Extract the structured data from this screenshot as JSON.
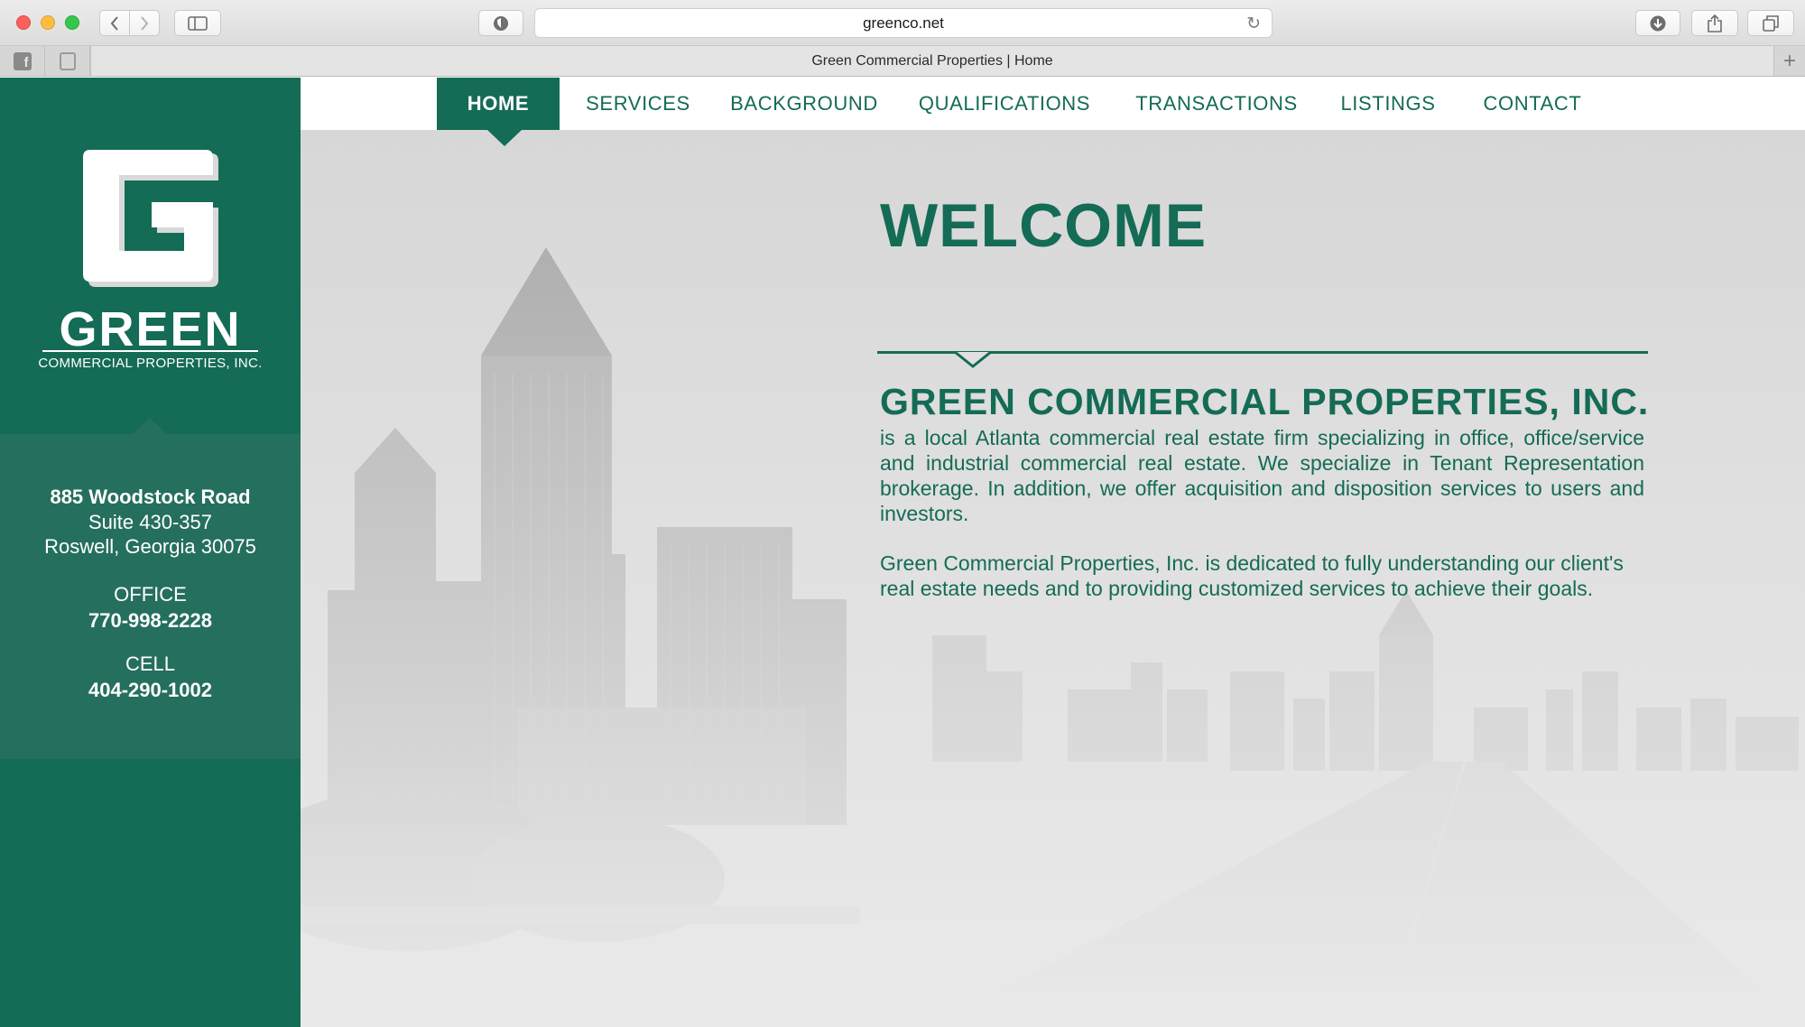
{
  "browser": {
    "url": "greenco.net",
    "tab_title": "Green Commercial Properties | Home",
    "icons": {
      "back": "chevron-left-icon",
      "forward": "chevron-right-icon",
      "sidebar": "sidebar-icon",
      "reader": "shield-icon",
      "reload": "reload-icon",
      "download": "download-icon",
      "share": "share-icon",
      "tabs": "tabs-overview-icon",
      "new_tab": "plus-icon"
    },
    "favorites": [
      "facebook-icon",
      "bot-icon"
    ]
  },
  "brand": {
    "name": "GREEN",
    "subtitle": "COMMERCIAL PROPERTIES, INC.",
    "logo_letter": "G",
    "primary_color": "#146b56",
    "panel_color": "#256f5e"
  },
  "contact": {
    "street": "885 Woodstock Road",
    "suite": "Suite 430-357",
    "city": "Roswell, Georgia 30075",
    "office_label": "OFFICE",
    "office_phone": "770-998-2228",
    "cell_label": "CELL",
    "cell_phone": "404-290-1002"
  },
  "nav": {
    "items": [
      {
        "label": "HOME",
        "active": true
      },
      {
        "label": "SERVICES"
      },
      {
        "label": "BACKGROUND"
      },
      {
        "label": "QUALIFICATIONS"
      },
      {
        "label": "TRANSACTIONS"
      },
      {
        "label": "LISTINGS"
      },
      {
        "label": "CONTACT"
      }
    ]
  },
  "main": {
    "heading": "WELCOME",
    "company": "GREEN COMMERCIAL PROPERTIES, INC.",
    "paragraph1": "is a local Atlanta commercial real estate firm specializing in office, office/service and industrial commercial real estate. We specialize in Tenant Representation brokerage. In addition, we offer acquisition and disposition services to users and investors.",
    "paragraph2": "Green Commercial Properties, Inc. is dedicated to fully understanding our client's real estate needs and to providing customized services to achieve their goals."
  }
}
